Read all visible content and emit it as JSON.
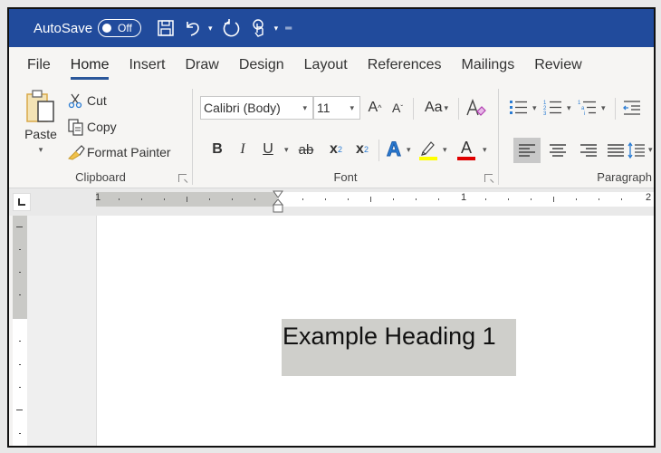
{
  "titlebar": {
    "autosave_label": "AutoSave",
    "autosave_state": "Off",
    "icons": [
      "save-icon",
      "undo-icon",
      "redo-icon",
      "touch-mode-icon",
      "customize-qat-icon"
    ]
  },
  "tabs": [
    {
      "label": "File",
      "active": false
    },
    {
      "label": "Home",
      "active": true
    },
    {
      "label": "Insert",
      "active": false
    },
    {
      "label": "Draw",
      "active": false
    },
    {
      "label": "Design",
      "active": false
    },
    {
      "label": "Layout",
      "active": false
    },
    {
      "label": "References",
      "active": false
    },
    {
      "label": "Mailings",
      "active": false
    },
    {
      "label": "Review",
      "active": false
    }
  ],
  "ribbon": {
    "clipboard": {
      "label": "Clipboard",
      "paste": "Paste",
      "cut": "Cut",
      "copy": "Copy",
      "format_painter": "Format Painter"
    },
    "font": {
      "label": "Font",
      "font_name": "Calibri (Body)",
      "font_size": "11",
      "grow_font": "A",
      "shrink_font": "A",
      "change_case": "Aa",
      "bold": "B",
      "italic": "I",
      "underline": "U",
      "strikethrough": "ab",
      "subscript": "x",
      "subscript_mark": "2",
      "superscript": "x",
      "superscript_mark": "2",
      "text_effects": "A",
      "font_color": "A",
      "highlight_color": "#ffff00",
      "font_color_value": "#e00000"
    },
    "paragraph": {
      "label": "Paragraph"
    }
  },
  "ruler": {
    "labels": [
      "1",
      "1",
      "2"
    ]
  },
  "document": {
    "heading_text": "Example Heading 1"
  },
  "colors": {
    "titlebar": "#214b9c",
    "accent": "#2b579a"
  }
}
